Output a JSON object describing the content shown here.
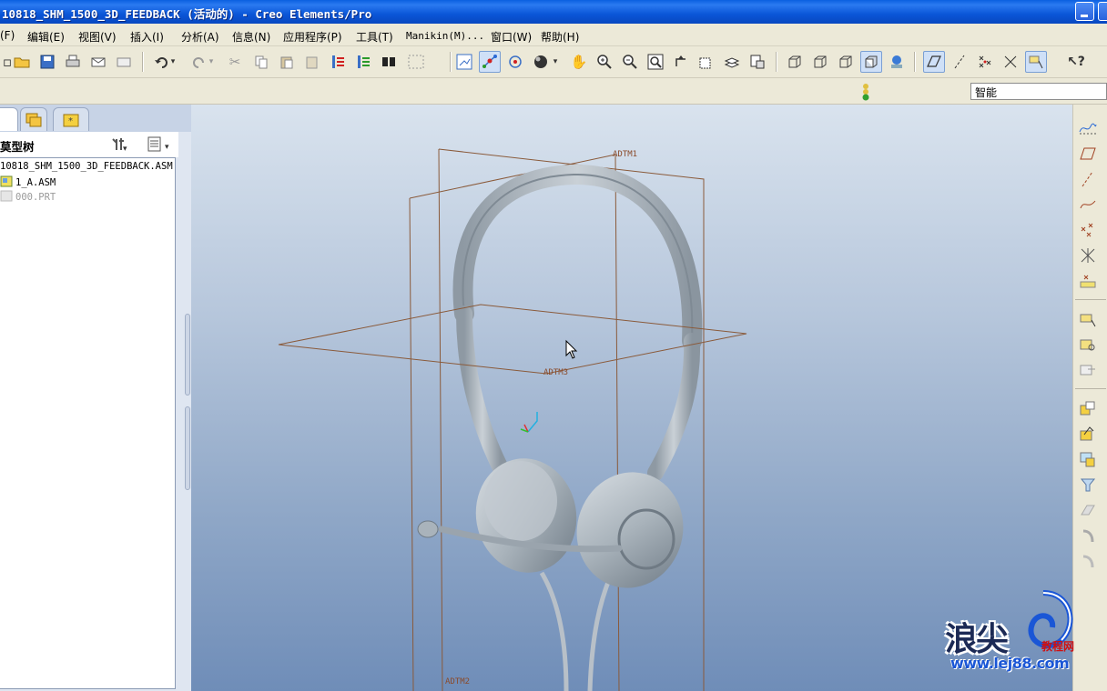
{
  "window": {
    "title": "10818_SHM_1500_3D_FEEDBACK (活动的) - Creo Elements/Pro"
  },
  "menu": {
    "items": [
      {
        "label": "(F)"
      },
      {
        "label": "编辑(E)"
      },
      {
        "label": "视图(V)"
      },
      {
        "label": "插入(I)"
      },
      {
        "label": "分析(A)"
      },
      {
        "label": "信息(N)"
      },
      {
        "label": "应用程序(P)"
      },
      {
        "label": "工具(T)"
      },
      {
        "label": "Manikin(M)..."
      },
      {
        "label": "窗口(W)"
      },
      {
        "label": "帮助(H)"
      }
    ]
  },
  "toolbar": {
    "icons": [
      "open-icon",
      "save-icon",
      "print-icon",
      "email-icon",
      "email-attach-icon",
      "undo-icon",
      "redo-icon",
      "cut-icon",
      "copy-icon",
      "paste-icon",
      "paste-special-icon",
      "regenerate-icon",
      "regen-manager-icon",
      "find-icon",
      "select-box-icon",
      "repaint-icon",
      "spin-center-icon",
      "orient-mode-icon",
      "appearance-icon",
      "pan-icon",
      "zoom-in-icon",
      "zoom-out-icon",
      "refit-icon",
      "reorient-icon",
      "saved-views-icon",
      "layers-icon",
      "view-manager-icon",
      "wireframe-icon",
      "hidden-line-icon",
      "no-hidden-icon",
      "shading-icon",
      "enhanced-realism-icon",
      "datum-planes-icon",
      "datum-axes-icon",
      "datum-points-icon",
      "coord-sys-icon",
      "annotations-icon",
      "context-help-icon"
    ]
  },
  "filter": {
    "value": "智能"
  },
  "left_panel": {
    "tree_title": "模型树",
    "tree_title_visible": "莫型树",
    "rows": [
      {
        "label": "10818_SHM_1500_3D_FEEDBACK.ASM",
        "dim": false
      },
      {
        "label": "1_A.ASM",
        "dim": false
      },
      {
        "label": "000.PRT",
        "dim": true
      }
    ]
  },
  "graphics": {
    "datums": {
      "plane1": "ADTM1",
      "plane2": "ADTM2",
      "plane3": "ADTM3"
    }
  },
  "right_toolbar": {
    "icons": [
      "sketch-curve-icon",
      "datum-plane-icon",
      "datum-axis-icon",
      "datum-curve-icon",
      "datum-point-icon",
      "offset-point-icon",
      "field-point-icon",
      "assemble-component-icon",
      "create-component-icon",
      "package-icon",
      "copy-geometry-icon",
      "publish-geometry-icon",
      "shrinkwrap-icon",
      "merge-icon",
      "cutout-icon",
      "flexible-icon",
      "mirror-icon"
    ]
  },
  "watermark": {
    "main": "浪尖",
    "sub": "教程网",
    "url": "www.lej88.com"
  },
  "colors": {
    "titlebar": "#0a56d8",
    "datum": "#8a5a3a",
    "headset": "#a9b3bb"
  }
}
